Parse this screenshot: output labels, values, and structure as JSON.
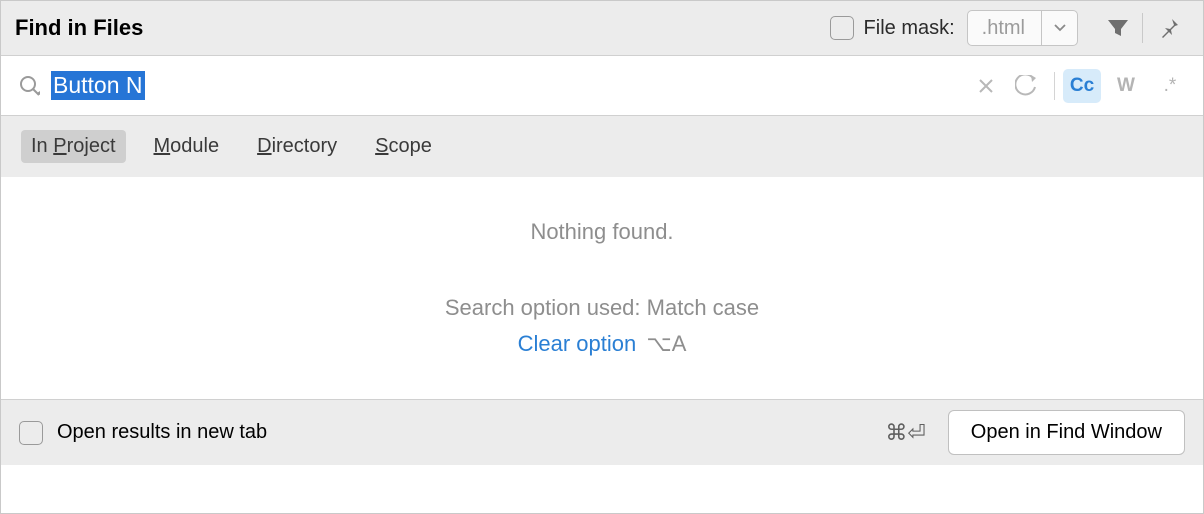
{
  "header": {
    "title": "Find in Files",
    "file_mask_label": "File mask:",
    "file_mask_value": ".html"
  },
  "search": {
    "query": "Button N",
    "toggles": {
      "match_case": "Cc",
      "words": "W",
      "regex": ".*"
    }
  },
  "scope": {
    "tabs": [
      "In Project",
      "Module",
      "Directory",
      "Scope"
    ]
  },
  "results": {
    "empty": "Nothing found.",
    "option_used": "Search option used: Match case",
    "clear_link": "Clear option",
    "clear_shortcut": "⌥A"
  },
  "footer": {
    "new_tab_label": "Open results in new tab",
    "shortcut": "⌘⏎",
    "open_button": "Open in Find Window"
  }
}
